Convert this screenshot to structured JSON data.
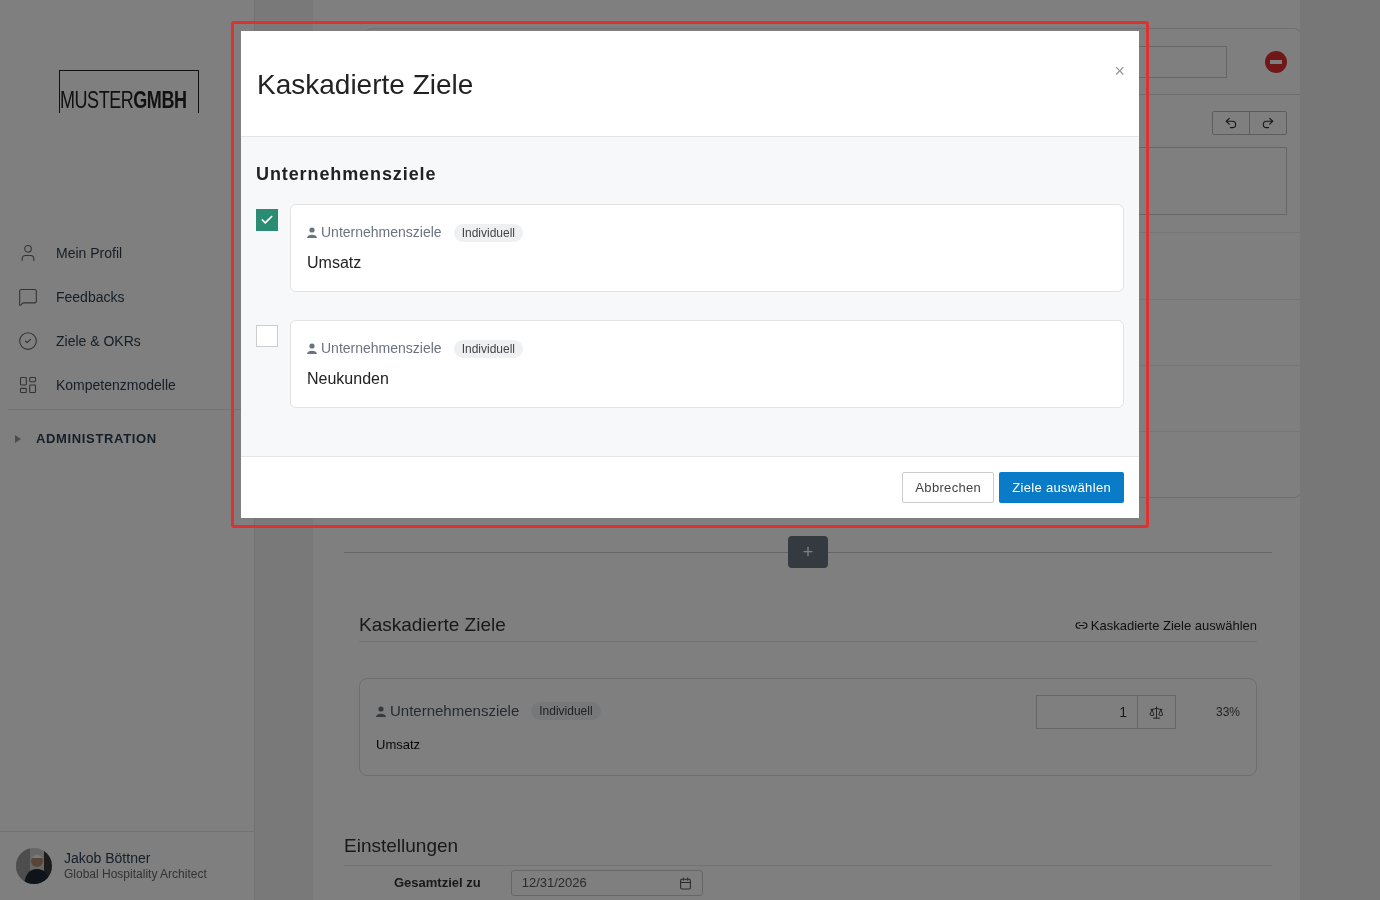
{
  "sidebar": {
    "logo": {
      "light": "MUSTER",
      "bold": "GMBH"
    },
    "items": [
      {
        "label": "Mein Profil"
      },
      {
        "label": "Feedbacks"
      },
      {
        "label": "Ziele & OKRs"
      },
      {
        "label": "Kompetenzmodelle"
      }
    ],
    "section": {
      "label": "ADMINISTRATION",
      "expanded": false
    },
    "user": {
      "name": "Jakob Böttner",
      "role": "Global Hospitality Architect"
    }
  },
  "content": {
    "add_button": "+",
    "cascade": {
      "title": "Kaskadierte Ziele",
      "link": "Kaskadierte Ziele auswählen",
      "goals": [
        {
          "category": "Unternehmensziele",
          "tag": "Individuell",
          "name": "Umsatz",
          "weight": "1",
          "share": "33%"
        }
      ]
    },
    "settings": {
      "title": "Einstellungen",
      "fields": [
        {
          "label": "Gesamtziel zu",
          "value": "12/31/2026"
        }
      ]
    }
  },
  "modal": {
    "title": "Kaskadierte Ziele",
    "close": "×",
    "section": "Unternehmensziele",
    "goals": [
      {
        "checked": true,
        "category": "Unternehmensziele",
        "tag": "Individuell",
        "name": "Umsatz"
      },
      {
        "checked": false,
        "category": "Unternehmensziele",
        "tag": "Individuell",
        "name": "Neukunden"
      }
    ],
    "buttons": [
      {
        "label": "Abbrechen",
        "kind": "secondary"
      },
      {
        "label": "Ziele auswählen",
        "kind": "primary"
      }
    ]
  }
}
